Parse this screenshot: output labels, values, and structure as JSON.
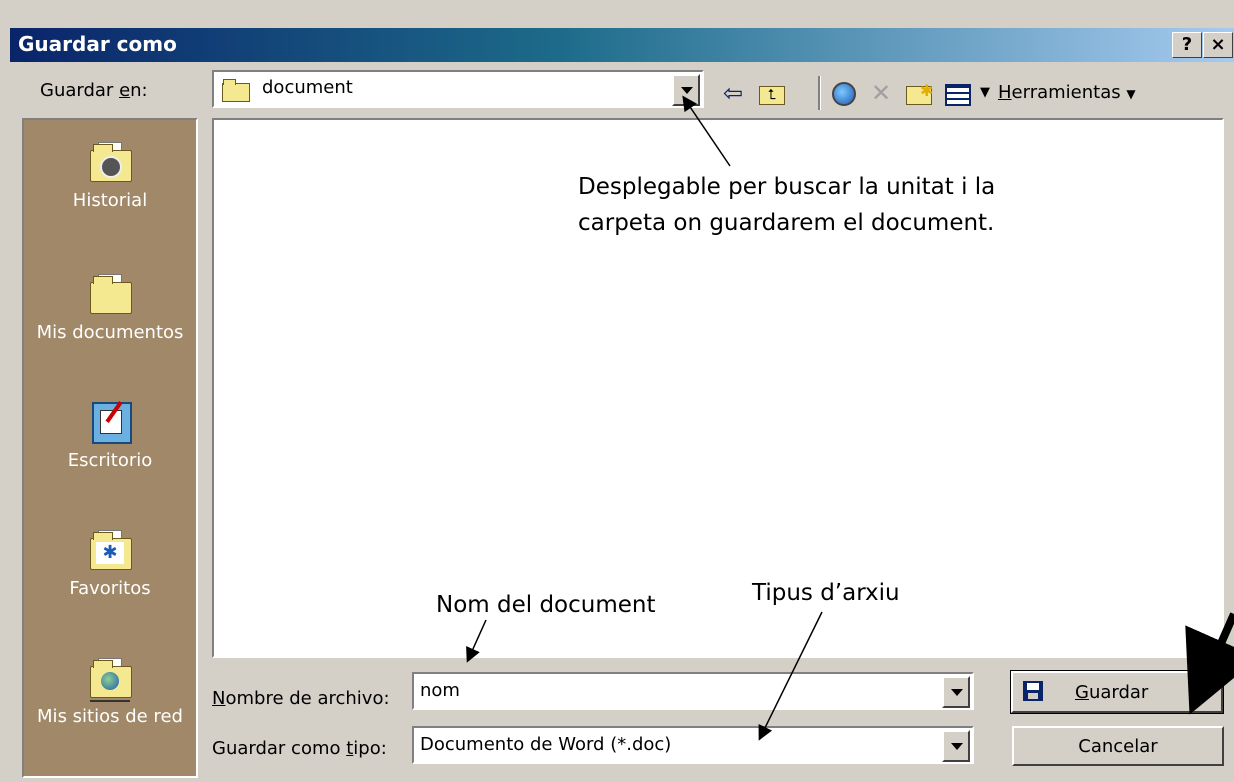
{
  "window": {
    "title": "Guardar como",
    "help_btn": "?",
    "close_btn": "×"
  },
  "toolbar": {
    "save_in_label_pre": "Guardar ",
    "save_in_label_u": "e",
    "save_in_label_post": "n:",
    "folder_value": "document",
    "tools_u": "H",
    "tools_rest": "erramientas"
  },
  "places": [
    {
      "label": "Historial"
    },
    {
      "label": "Mis documentos"
    },
    {
      "label": "Escritorio"
    },
    {
      "label": "Favoritos"
    },
    {
      "label": "Mis sitios de red"
    }
  ],
  "filename": {
    "label_u": "N",
    "label_rest": "ombre de archivo:",
    "value": "nom"
  },
  "filetype": {
    "label_pre": "Guardar como ",
    "label_u": "t",
    "label_post": "ipo:",
    "value": "Documento de Word (*.doc)"
  },
  "buttons": {
    "save_u": "G",
    "save_rest": "uardar",
    "cancel": "Cancelar"
  },
  "annotations": {
    "dropdown_line1": "Desplegable per buscar la unitat i la",
    "dropdown_line2": "carpeta on guardarem  el document.",
    "doc_name": "Nom del document",
    "file_type": "Tipus d’arxiu"
  }
}
